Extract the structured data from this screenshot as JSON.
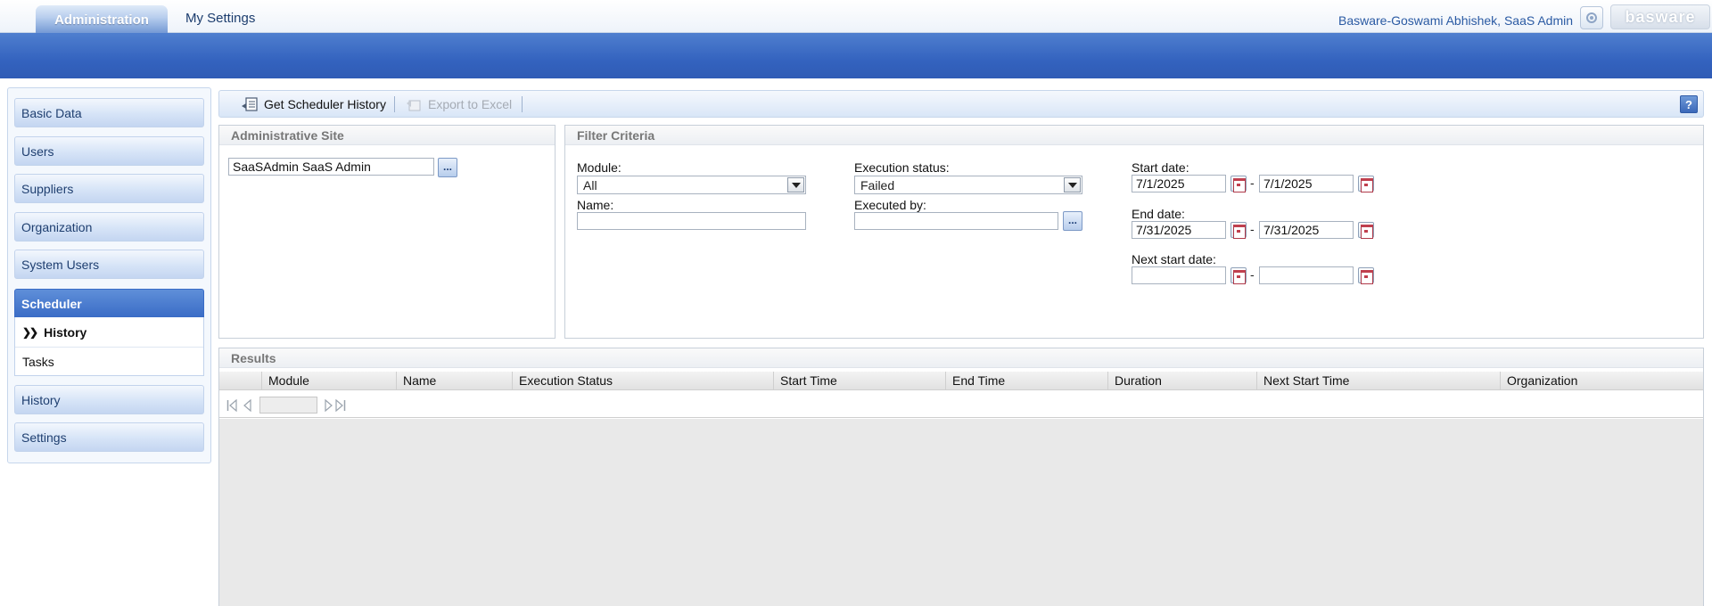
{
  "header": {
    "tabs": [
      {
        "label": "Administration",
        "active": true
      },
      {
        "label": "My Settings",
        "active": false
      }
    ],
    "user": "Basware-Goswami Abhishek, SaaS Admin",
    "logo_text": "basware",
    "power_icon": "power-icon"
  },
  "sidebar": {
    "items": [
      {
        "label": "Basic Data"
      },
      {
        "label": "Users"
      },
      {
        "label": "Suppliers"
      },
      {
        "label": "Organization"
      },
      {
        "label": "System Users"
      },
      {
        "label": "Scheduler",
        "active": true
      },
      {
        "label": "History"
      },
      {
        "label": "Settings"
      }
    ],
    "sub_items": [
      {
        "label": "History",
        "current": true
      },
      {
        "label": "Tasks"
      }
    ]
  },
  "toolbar": {
    "get_history": "Get Scheduler History",
    "export_excel": "Export to Excel",
    "help": "?"
  },
  "admin_site": {
    "title": "Administrative Site",
    "value": "SaaSAdmin SaaS Admin",
    "browse": "..."
  },
  "filter": {
    "title": "Filter Criteria",
    "module_label": "Module:",
    "module_value": "All",
    "name_label": "Name:",
    "name_value": "",
    "status_label": "Execution status:",
    "status_value": "Failed",
    "executed_by_label": "Executed by:",
    "executed_by_value": "",
    "browse": "...",
    "start_label": "Start date:",
    "start_from": "7/1/2025",
    "start_to": "7/1/2025",
    "end_label": "End date:",
    "end_from": "7/31/2025",
    "end_to": "7/31/2025",
    "next_label": "Next start date:",
    "next_from": "",
    "next_to": "",
    "dash": "-"
  },
  "results": {
    "title": "Results",
    "columns": [
      "Module",
      "Name",
      "Execution Status",
      "Start Time",
      "End Time",
      "Duration",
      "Next Start Time",
      "Organization"
    ]
  },
  "colors": {
    "accent": "#3463bf",
    "nav_text": "#1f3f70"
  }
}
